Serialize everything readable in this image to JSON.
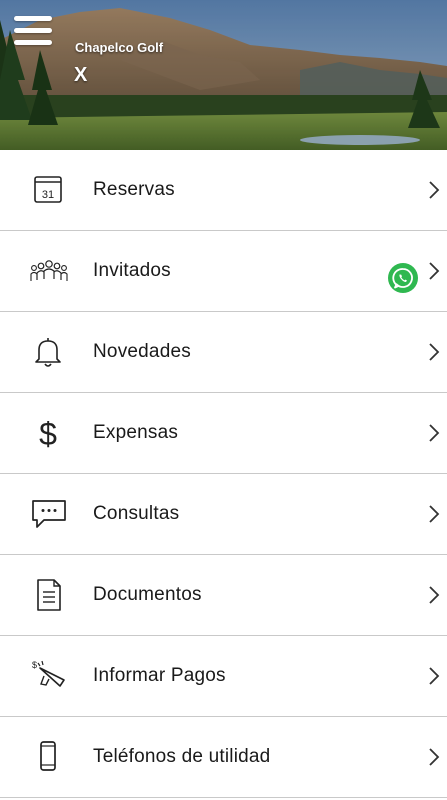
{
  "header": {
    "club_name": "Chapelco Golf",
    "user_initial": "X"
  },
  "menu": [
    {
      "label": "Reservas",
      "icon": "calendar-icon",
      "calendar_day": "31"
    },
    {
      "label": "Invitados",
      "icon": "people-icon"
    },
    {
      "label": "Novedades",
      "icon": "bell-icon"
    },
    {
      "label": "Expensas",
      "icon": "dollar-icon",
      "symbol": "$"
    },
    {
      "label": "Consultas",
      "icon": "chat-bubble-icon"
    },
    {
      "label": "Documentos",
      "icon": "document-icon"
    },
    {
      "label": "Informar Pagos",
      "icon": "megaphone-icon"
    },
    {
      "label": "Teléfonos de utilidad",
      "icon": "phone-icon"
    }
  ],
  "whatsapp": {
    "icon": "whatsapp-icon",
    "color": "#2fb850"
  },
  "colors": {
    "text": "#1a1a1a",
    "divider": "#c9c9c9",
    "icon": "#222222"
  }
}
